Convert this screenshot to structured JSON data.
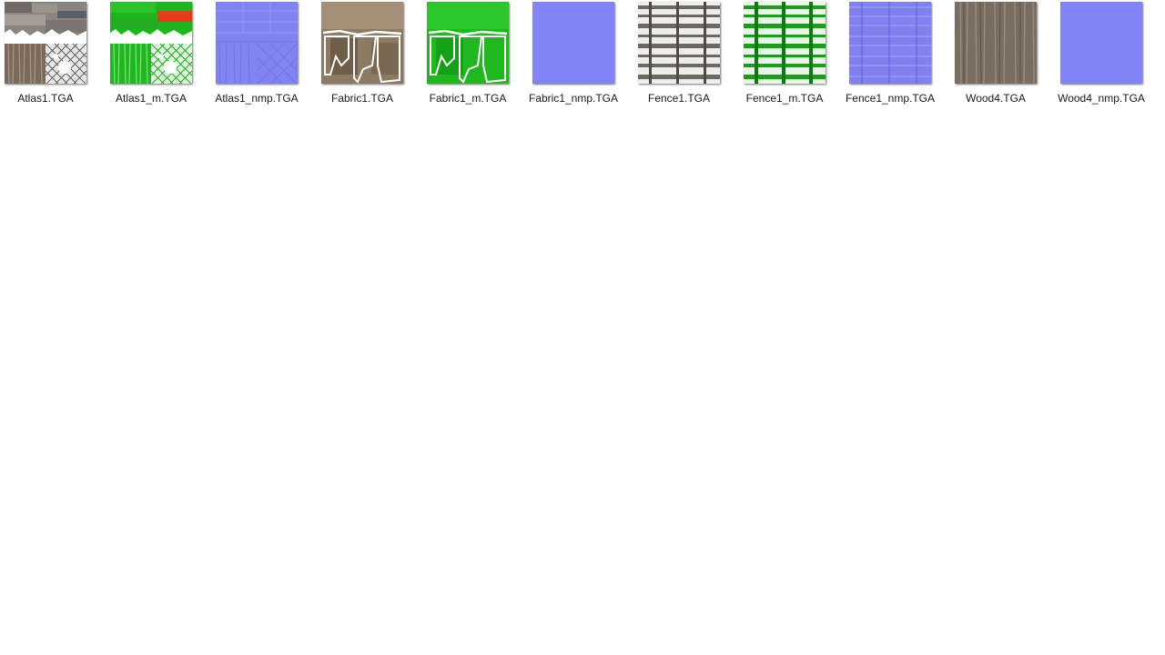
{
  "files": [
    {
      "name": "Atlas1.TGA",
      "icon": "atlas-texture-thumbnail"
    },
    {
      "name": "Atlas1_m.TGA",
      "icon": "atlas-mask-thumbnail"
    },
    {
      "name": "Atlas1_nmp.TGA",
      "icon": "atlas-normal-map-thumbnail"
    },
    {
      "name": "Fabric1.TGA",
      "icon": "fabric-texture-thumbnail"
    },
    {
      "name": "Fabric1_m.TGA",
      "icon": "fabric-mask-thumbnail"
    },
    {
      "name": "Fabric1_nmp.TGA",
      "icon": "fabric-normal-map-thumbnail"
    },
    {
      "name": "Fence1.TGA",
      "icon": "fence-texture-thumbnail"
    },
    {
      "name": "Fence1_m.TGA",
      "icon": "fence-mask-thumbnail"
    },
    {
      "name": "Fence1_nmp.TGA",
      "icon": "fence-normal-map-thumbnail"
    },
    {
      "name": "Wood4.TGA",
      "icon": "wood-texture-thumbnail"
    },
    {
      "name": "Wood4_nmp.TGA",
      "icon": "wood-normal-map-thumbnail"
    }
  ],
  "colors": {
    "normal_map": "#8080f8",
    "mask_green": "#1ec81e",
    "wood": "#7a6e62"
  }
}
